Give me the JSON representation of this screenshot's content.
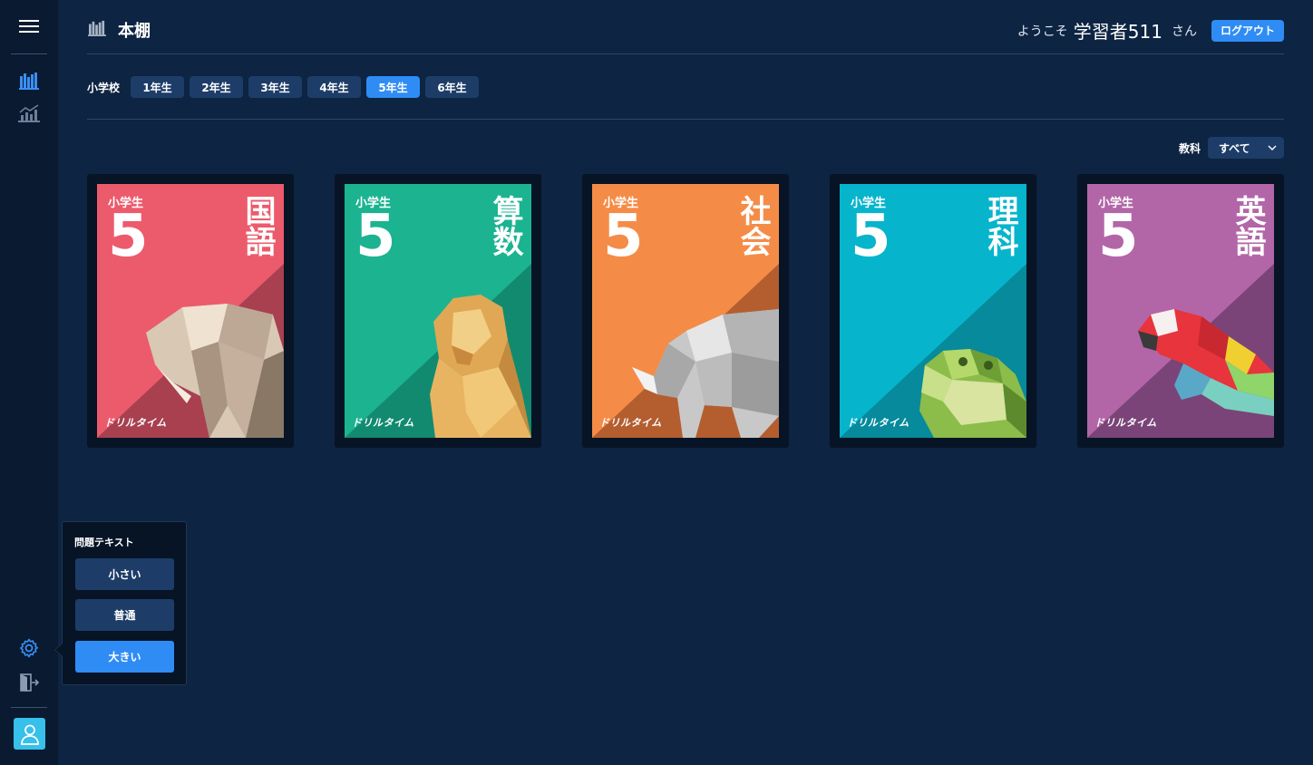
{
  "header": {
    "title": "本棚",
    "welcome": "ようこそ",
    "username": "学習者511",
    "honorific": "さん",
    "logout_label": "ログアウト"
  },
  "grades": {
    "school_label": "小学校",
    "tabs": [
      {
        "label": "1年生",
        "active": false
      },
      {
        "label": "2年生",
        "active": false
      },
      {
        "label": "3年生",
        "active": false
      },
      {
        "label": "4年生",
        "active": false
      },
      {
        "label": "5年生",
        "active": true
      },
      {
        "label": "6年生",
        "active": false
      }
    ]
  },
  "filter": {
    "label": "教科",
    "selected": "すべて"
  },
  "books": [
    {
      "school": "小学生",
      "grade": "5",
      "subject": "国語",
      "brand": "ドリルタイム",
      "animal": "elephant",
      "color": "#ec5b6c",
      "dark": "#a8404f"
    },
    {
      "school": "小学生",
      "grade": "5",
      "subject": "算数",
      "brand": "ドリルタイム",
      "animal": "lion",
      "color": "#1cb391",
      "dark": "#128a70"
    },
    {
      "school": "小学生",
      "grade": "5",
      "subject": "社会",
      "brand": "ドリルタイム",
      "animal": "rhino",
      "color": "#f48c47",
      "dark": "#b45e30"
    },
    {
      "school": "小学生",
      "grade": "5",
      "subject": "理科",
      "brand": "ドリルタイム",
      "animal": "frog",
      "color": "#06b5cc",
      "dark": "#068a9c"
    },
    {
      "school": "小学生",
      "grade": "5",
      "subject": "英語",
      "brand": "ドリルタイム",
      "animal": "parrot",
      "color": "#b266a8",
      "dark": "#7a4478"
    }
  ],
  "text_size": {
    "title": "問題テキスト",
    "options": [
      {
        "label": "小さい",
        "active": false
      },
      {
        "label": "普通",
        "active": false
      },
      {
        "label": "大きい",
        "active": true
      }
    ]
  },
  "colors": {
    "background": "#0d2442",
    "sidebar": "#0a1a30",
    "accent": "#2f8cf5",
    "tab": "#1d3d68"
  },
  "icons": {
    "menu": "hamburger-icon",
    "bookshelf": "bookshelf-icon",
    "stats": "chart-icon",
    "settings": "gear-icon",
    "exit": "exit-door-icon",
    "user": "user-icon",
    "dropdown": "chevron-down-icon"
  }
}
